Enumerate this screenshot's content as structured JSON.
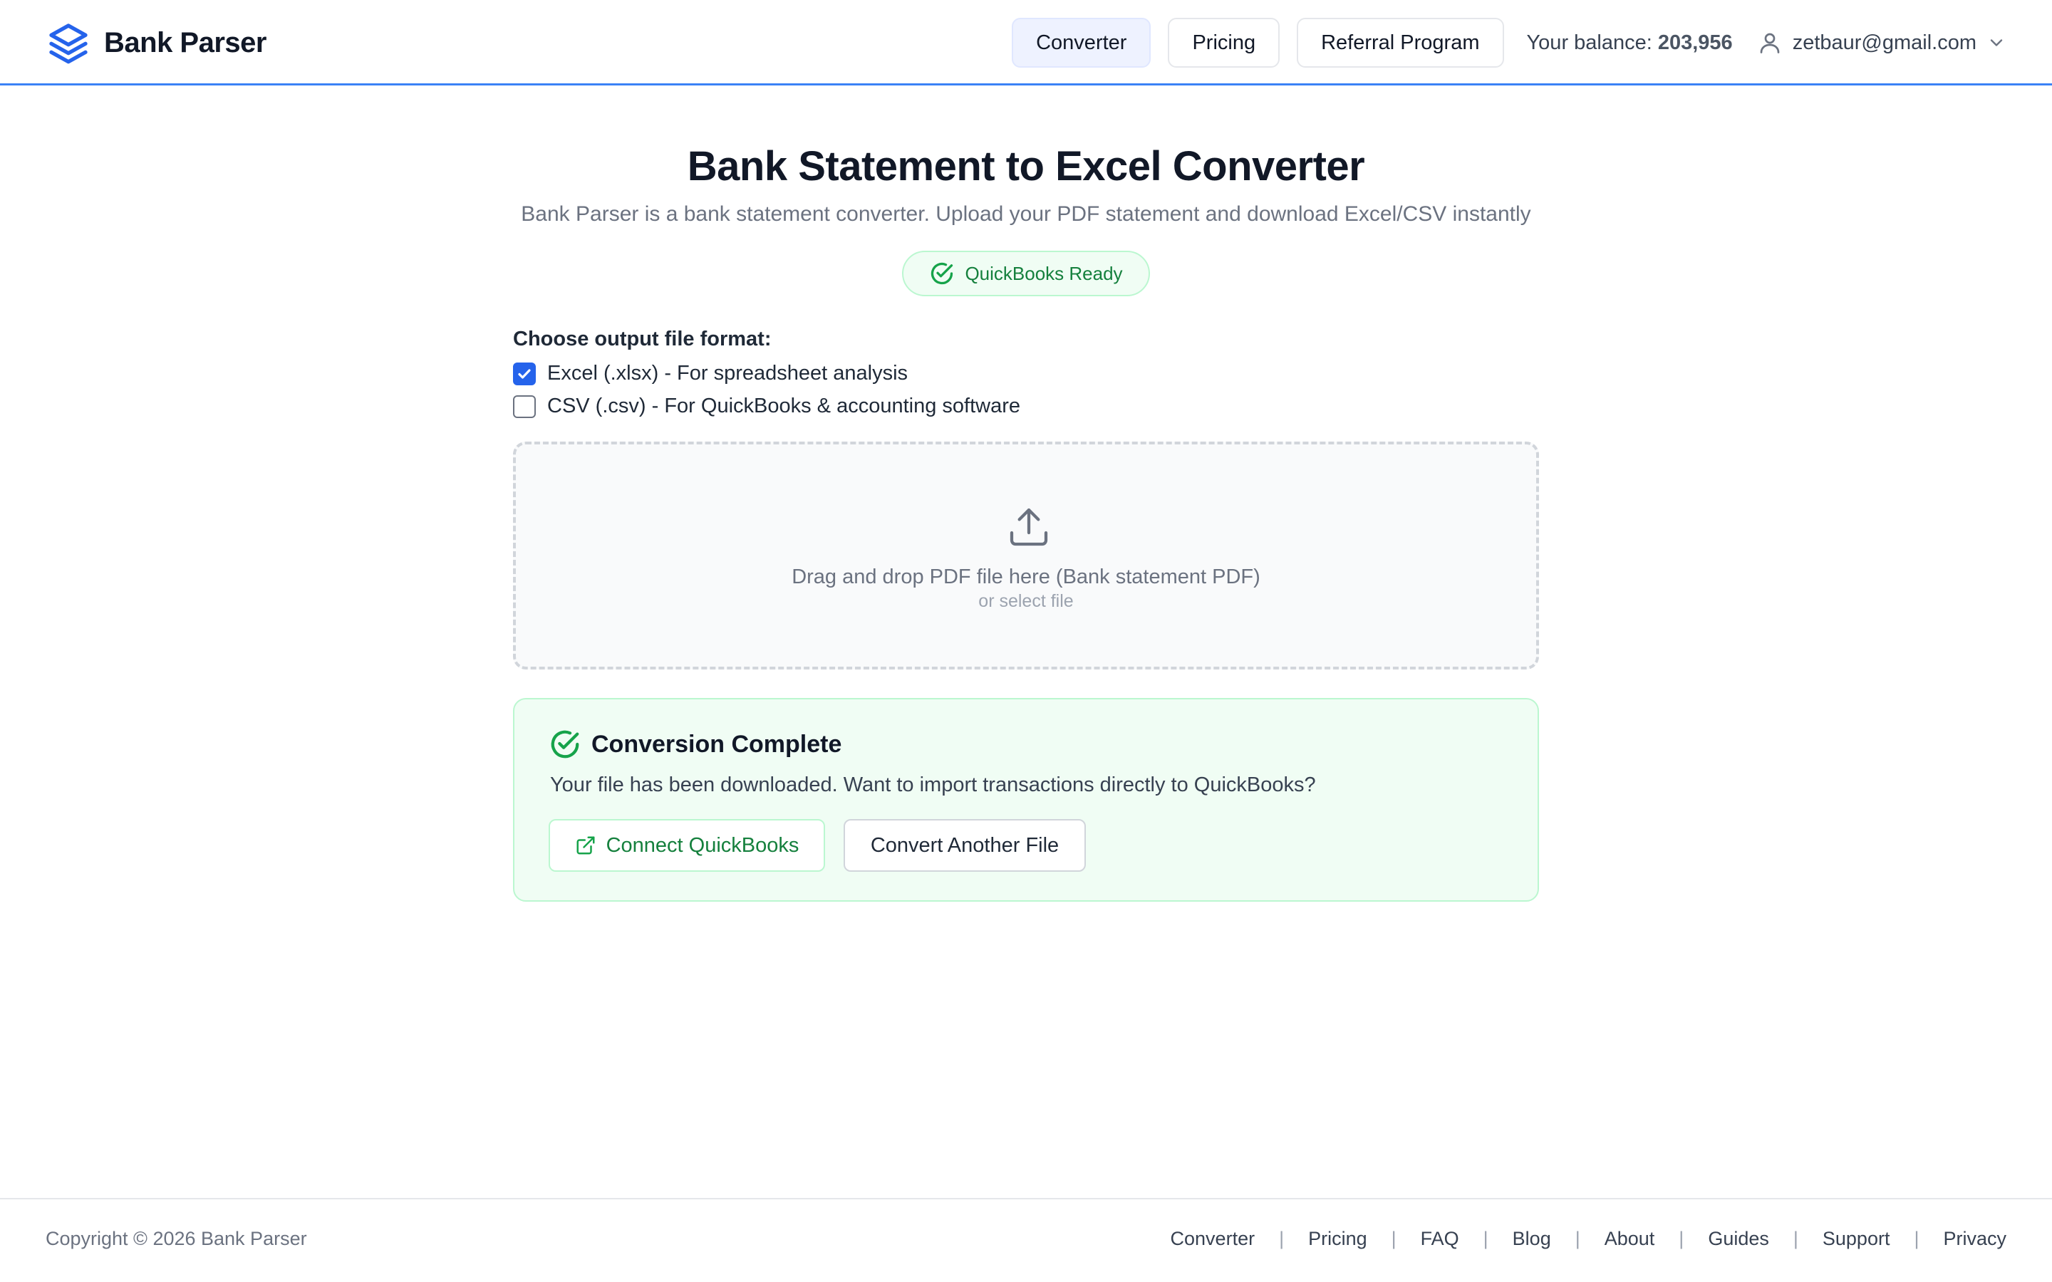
{
  "colors": {
    "accent": "#2563eb",
    "header_border": "#3b82f6",
    "success": "#16a34a",
    "success_bg": "#f0fdf4",
    "text": "#111827",
    "muted": "#6b7280"
  },
  "header": {
    "logo_icon": "stack-layers-icon",
    "app_name": "Bank Parser",
    "nav": [
      {
        "label": "Converter",
        "active": true
      },
      {
        "label": "Pricing",
        "active": false
      },
      {
        "label": "Referral Program",
        "active": false
      }
    ],
    "balance_label": "Your balance:",
    "balance_value": "203,956",
    "user_icon": "user-icon",
    "user_email": "zetbaur@gmail.com",
    "dropdown_icon": "chevron-down-icon"
  },
  "main": {
    "title": "Bank Statement to Excel Converter",
    "subtitle": "Bank Parser is a bank statement converter. Upload your PDF statement and download Excel/CSV instantly",
    "badge": {
      "icon": "check-circle-icon",
      "label": "QuickBooks Ready"
    },
    "format": {
      "label": "Choose output file format:",
      "options": [
        {
          "label": "Excel (.xlsx) - For spreadsheet analysis",
          "checked": true
        },
        {
          "label": "CSV (.csv) - For QuickBooks & accounting software",
          "checked": false
        }
      ]
    },
    "dropzone": {
      "icon": "upload-icon",
      "text": "Drag and drop PDF file here (Bank statement PDF)",
      "subtext": "or select file"
    },
    "complete": {
      "icon": "check-circle-icon",
      "title": "Conversion Complete",
      "message": "Your file has been downloaded. Want to import transactions directly to QuickBooks?",
      "connect_icon": "external-link-icon",
      "connect_label": "Connect QuickBooks",
      "another_label": "Convert Another File"
    }
  },
  "footer": {
    "copyright": "Copyright © 2026 Bank Parser",
    "separator": "|",
    "links": [
      "Converter",
      "Pricing",
      "FAQ",
      "Blog",
      "About",
      "Guides",
      "Support",
      "Privacy"
    ]
  }
}
